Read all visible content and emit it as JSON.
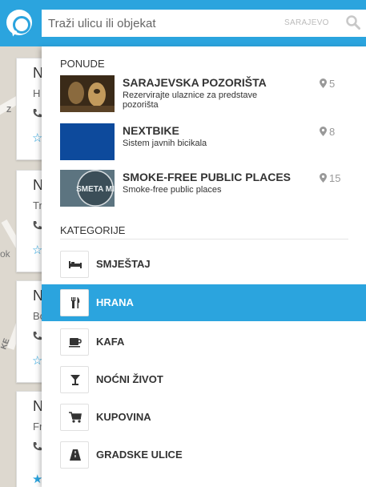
{
  "header": {
    "search_placeholder": "Traži ulicu ili objekat",
    "city": "SARAJEVO"
  },
  "background_cards": [
    {
      "title": "N",
      "sub": "H"
    },
    {
      "title": "N",
      "sub": "Tr"
    },
    {
      "title": "N",
      "sub": "Bo"
    },
    {
      "title": "N",
      "sub": "Fr"
    }
  ],
  "map_labels": {
    "left_a": "Z",
    "left_b": "ok",
    "left_c": "KE"
  },
  "offers_section": {
    "title": "PONUDE",
    "items": [
      {
        "name": "SARAJEVSKA POZORIŠTA",
        "description": "Rezervirajte ulaznice za predstave pozorišta",
        "count": "5"
      },
      {
        "name": "NEXTBIKE",
        "description": "Sistem javnih bicikala",
        "count": "8"
      },
      {
        "name": "SMOKE-FREE PUBLIC PLACES",
        "description": "Smoke-free public places",
        "count": "15",
        "thumb_text": "SMETA MI"
      }
    ]
  },
  "categories_section": {
    "title": "KATEGORIJE",
    "items": [
      {
        "label": "SMJEŠTAJ",
        "icon": "bed-icon",
        "active": false
      },
      {
        "label": "HRANA",
        "icon": "fork-knife-icon",
        "active": true
      },
      {
        "label": "KAFA",
        "icon": "coffee-cup-icon",
        "active": false
      },
      {
        "label": "NOĆNI ŽIVOT",
        "icon": "cocktail-glass-icon",
        "active": false
      },
      {
        "label": "KUPOVINA",
        "icon": "shopping-cart-icon",
        "active": false
      },
      {
        "label": "GRADSKE ULICE",
        "icon": "road-icon",
        "active": false
      }
    ]
  },
  "colors": {
    "accent": "#2ba4de",
    "pin": "#999999"
  }
}
